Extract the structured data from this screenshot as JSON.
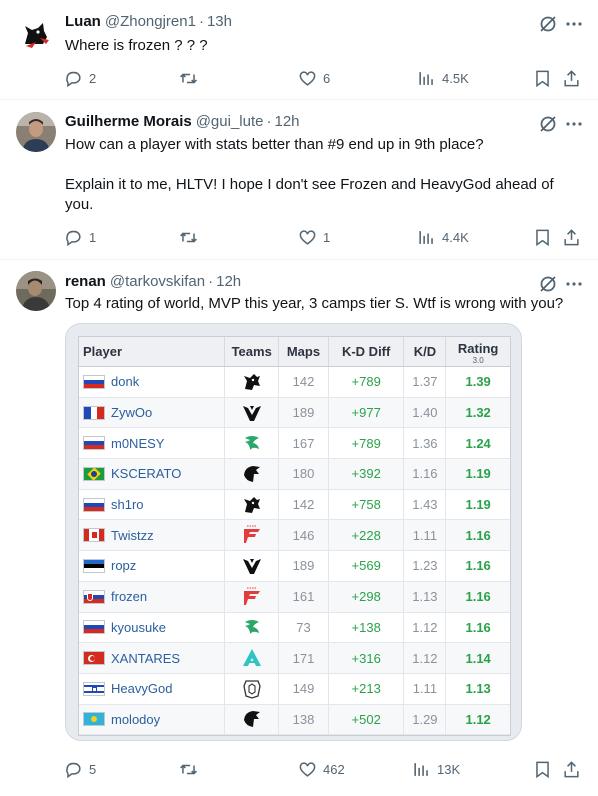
{
  "tweets": [
    {
      "name": "Luan",
      "handle": "@Zhongjren1",
      "time": "13h",
      "text": [
        "Where is frozen ? ? ?"
      ],
      "replies": "2",
      "retweets": "",
      "likes": "6",
      "views": "4.5K"
    },
    {
      "name": "Guilherme Morais",
      "handle": "@gui_lute",
      "time": "12h",
      "text": [
        "How can a player with stats better than #9 end up in 9th place?",
        "",
        "Explain it to me, HLTV! I hope I don't see Frozen and HeavyGod ahead of you."
      ],
      "replies": "1",
      "retweets": "",
      "likes": "1",
      "views": "4.4K"
    },
    {
      "name": "renan",
      "handle": "@tarkovskifan",
      "time": "12h",
      "text": [
        "Top 4 rating of world, MVP this year, 3 camps tier S. Wtf is wrong with you?"
      ],
      "replies": "5",
      "retweets": "",
      "likes": "462",
      "views": "13K"
    }
  ],
  "table": {
    "headers": {
      "player": "Player",
      "teams": "Teams",
      "maps": "Maps",
      "kd_diff": "K-D Diff",
      "kd": "K/D",
      "rating": "Rating",
      "rating_version": "3.0"
    },
    "rows": [
      {
        "player": "donk",
        "flag": "ru",
        "team": "spirit",
        "maps": "142",
        "kd_diff": "+789",
        "kd": "1.37",
        "rating": "1.39"
      },
      {
        "player": "ZywOo",
        "flag": "fr",
        "team": "vitality",
        "maps": "189",
        "kd_diff": "+977",
        "kd": "1.40",
        "rating": "1.32"
      },
      {
        "player": "m0NESY",
        "flag": "ru",
        "team": "falcons",
        "maps": "167",
        "kd_diff": "+789",
        "kd": "1.36",
        "rating": "1.24"
      },
      {
        "player": "KSCERATO",
        "flag": "br",
        "team": "furia",
        "maps": "180",
        "kd_diff": "+392",
        "kd": "1.16",
        "rating": "1.19"
      },
      {
        "player": "sh1ro",
        "flag": "ru",
        "team": "spirit",
        "maps": "142",
        "kd_diff": "+758",
        "kd": "1.43",
        "rating": "1.19"
      },
      {
        "player": "Twistzz",
        "flag": "ca",
        "team": "faze",
        "maps": "146",
        "kd_diff": "+228",
        "kd": "1.11",
        "rating": "1.16"
      },
      {
        "player": "ropz",
        "flag": "ee",
        "team": "vitality",
        "maps": "189",
        "kd_diff": "+569",
        "kd": "1.23",
        "rating": "1.16"
      },
      {
        "player": "frozen",
        "flag": "sk",
        "team": "faze",
        "maps": "161",
        "kd_diff": "+298",
        "kd": "1.13",
        "rating": "1.16"
      },
      {
        "player": "kyousuke",
        "flag": "ru",
        "team": "falcons",
        "maps": "73",
        "kd_diff": "+138",
        "kd": "1.12",
        "rating": "1.16"
      },
      {
        "player": "XANTARES",
        "flag": "tr",
        "team": "aurora",
        "maps": "171",
        "kd_diff": "+316",
        "kd": "1.12",
        "rating": "1.14"
      },
      {
        "player": "HeavyGod",
        "flag": "il",
        "team": "g2",
        "maps": "149",
        "kd_diff": "+213",
        "kd": "1.11",
        "rating": "1.13"
      },
      {
        "player": "molodoy",
        "flag": "kz",
        "team": "furia",
        "maps": "138",
        "kd_diff": "+502",
        "kd": "1.29",
        "rating": "1.12"
      }
    ]
  },
  "icons": [
    "reply-icon",
    "retweet-icon",
    "like-icon",
    "views-icon",
    "bookmark-icon",
    "share-icon",
    "grok-icon",
    "more-icon"
  ],
  "colors": {
    "text": "#0f1419",
    "muted": "#536471",
    "positive": "#2aa24a",
    "player_link": "#2b5f9e"
  }
}
